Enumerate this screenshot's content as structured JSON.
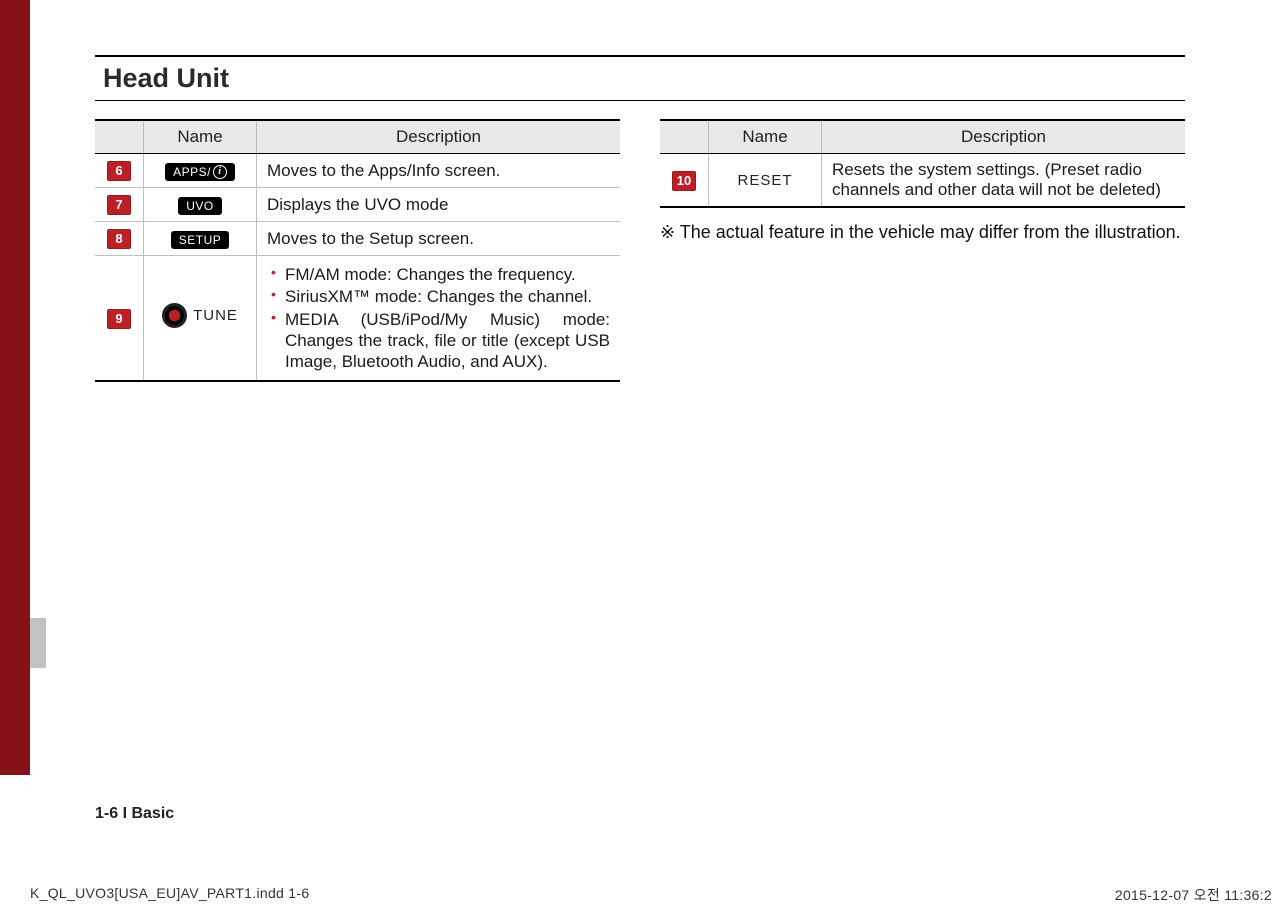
{
  "section_title": "Head Unit",
  "headers": {
    "name": "Name",
    "description": "Description"
  },
  "left_rows": [
    {
      "num": "6",
      "name_kind": "pill-info",
      "name_text": "APPS/",
      "desc_kind": "text",
      "desc": "Moves to the Apps/Info screen."
    },
    {
      "num": "7",
      "name_kind": "pill",
      "name_text": "UVO",
      "desc_kind": "text",
      "desc": "Displays the UVO mode"
    },
    {
      "num": "8",
      "name_kind": "pill",
      "name_text": "SETUP",
      "desc_kind": "text",
      "desc": "Moves to the Setup screen."
    },
    {
      "num": "9",
      "name_kind": "tune",
      "name_text": "TUNE",
      "desc_kind": "list",
      "desc_items": [
        "FM/AM mode: Changes the frequency.",
        "SiriusXM™ mode: Changes the channel.",
        "MEDIA (USB/iPod/My Music) mode: Changes the track, file or title (except USB Image, Bluetooth Audio, and AUX)."
      ]
    }
  ],
  "right_rows": [
    {
      "num": "10",
      "name_kind": "reset",
      "name_text": "RESET",
      "desc_kind": "text",
      "desc": "Resets the system settings. (Preset radio channels and other data will not be deleted)"
    }
  ],
  "note": "※ The actual feature in the vehicle may differ from the illustration.",
  "page_footer": "1-6 I Basic",
  "print_footer_left": "K_QL_UVO3[USA_EU]AV_PART1.indd   1-6",
  "print_footer_right": "2015-12-07   오전 11:36:2"
}
